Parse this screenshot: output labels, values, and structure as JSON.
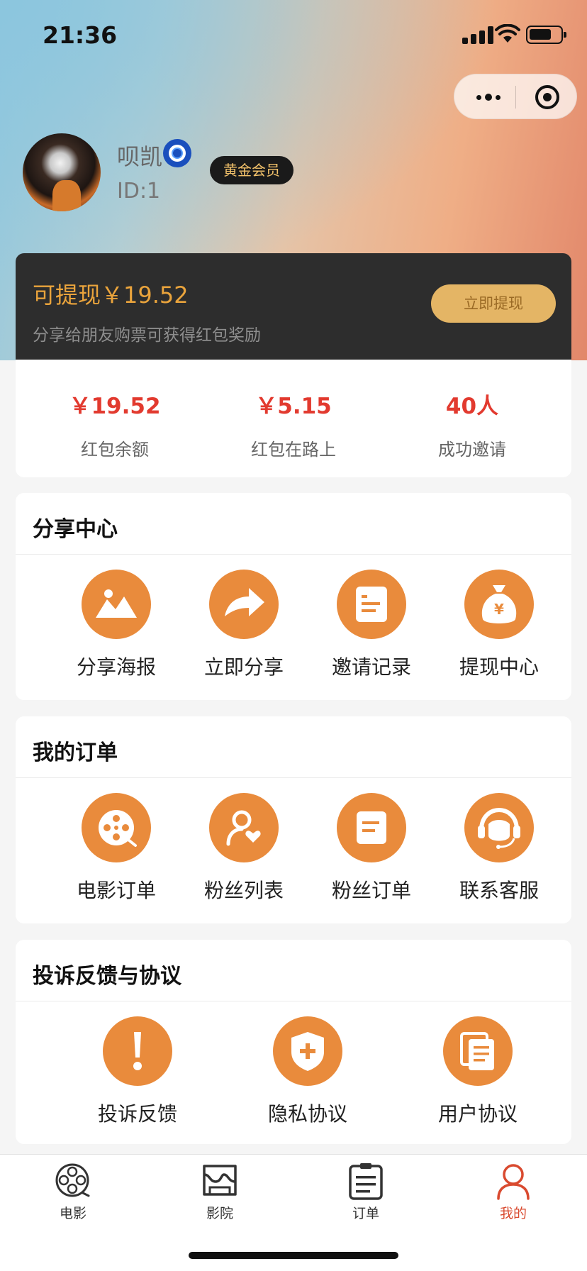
{
  "status_bar": {
    "time": "21:36"
  },
  "profile": {
    "username": "呗凯",
    "user_id": "ID:1",
    "member_level": "黄金会员"
  },
  "wallet": {
    "withdrawable": "可提现￥19.52",
    "hint": "分享给朋友购票可获得红包奖励",
    "withdraw_button": "立即提现"
  },
  "stats": [
    {
      "value": "￥19.52",
      "label": "红包余额"
    },
    {
      "value": "￥5.15",
      "label": "红包在路上"
    },
    {
      "value": "40人",
      "label": "成功邀请"
    }
  ],
  "share_center": {
    "title": "分享中心",
    "items": [
      {
        "label": "分享海报",
        "icon": "image-icon"
      },
      {
        "label": "立即分享",
        "icon": "share-arrow-icon"
      },
      {
        "label": "邀请记录",
        "icon": "document-icon"
      },
      {
        "label": "提现中心",
        "icon": "money-bag-icon"
      }
    ]
  },
  "my_orders": {
    "title": "我的订单",
    "items": [
      {
        "label": "电影订单",
        "icon": "film-reel-icon"
      },
      {
        "label": "粉丝列表",
        "icon": "fan-user-icon"
      },
      {
        "label": "粉丝订单",
        "icon": "order-icon"
      },
      {
        "label": "联系客服",
        "icon": "customer-service-icon"
      }
    ]
  },
  "feedback": {
    "title": "投诉反馈与协议",
    "items": [
      {
        "label": "投诉反馈",
        "icon": "exclamation-icon"
      },
      {
        "label": "隐私协议",
        "icon": "shield-plus-icon"
      },
      {
        "label": "用户协议",
        "icon": "documents-icon"
      }
    ]
  },
  "tabbar": [
    {
      "label": "电影",
      "icon": "film-reel-icon",
      "active": false
    },
    {
      "label": "影院",
      "icon": "cinema-icon",
      "active": false
    },
    {
      "label": "订单",
      "icon": "clipboard-icon",
      "active": false
    },
    {
      "label": "我的",
      "icon": "user-icon",
      "active": true
    }
  ],
  "colors": {
    "accent": "#e98b3c",
    "stat_value": "#e23a2f",
    "tab_active": "#d94a2f",
    "wallet_bg": "#2d2d2d",
    "withdraw_button": "#e4b565"
  }
}
